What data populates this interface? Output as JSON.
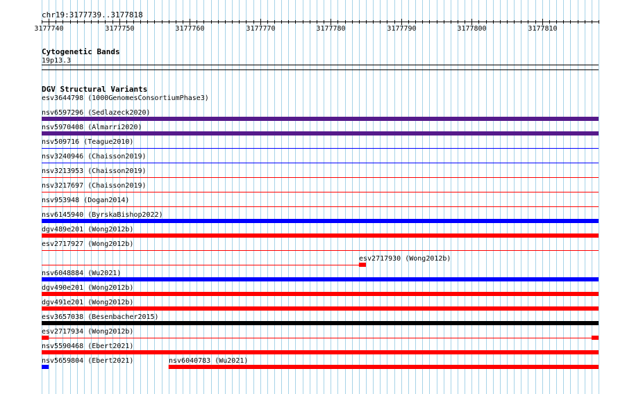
{
  "location": {
    "label": "chr19:3177739..3177818",
    "start": 3177739,
    "end": 3177818
  },
  "ruler": {
    "ticks": [
      3177740,
      3177750,
      3177760,
      3177770,
      3177780,
      3177790,
      3177800,
      3177810
    ]
  },
  "colors": {
    "grid": "#a6d3e8",
    "ruler": "#000000",
    "sv_red": "#ff0000",
    "sv_blue": "#0000ff",
    "sv_purple": "#551a8b",
    "sv_black": "#000000"
  },
  "cytobands": {
    "title": "Cytogenetic Bands",
    "band": "19p13.3"
  },
  "dgv": {
    "title": "DGV Structural Variants",
    "features": [
      {
        "label": "esv3644798 (1000GenomesConsortiumPhase3)",
        "lane": 0,
        "line_color": "",
        "blocks": []
      },
      {
        "label": "nsv6597296 (Sedlazeck2020)",
        "lane": 1,
        "line_color": "sv_purple",
        "blocks": [
          {
            "start": 3177739,
            "end": 3177818,
            "color": "sv_purple"
          }
        ]
      },
      {
        "label": "nsv5970408 (Almarri2020)",
        "lane": 2,
        "line_color": "sv_purple",
        "blocks": [
          {
            "start": 3177739,
            "end": 3177818,
            "color": "sv_purple"
          }
        ]
      },
      {
        "label": "nsv509716 (Teague2010)",
        "lane": 3,
        "line_color": "sv_blue",
        "blocks": []
      },
      {
        "label": "nsv3240946 (Chaisson2019)",
        "lane": 4,
        "line_color": "sv_blue",
        "blocks": []
      },
      {
        "label": "nsv3213953 (Chaisson2019)",
        "lane": 5,
        "line_color": "sv_red",
        "blocks": []
      },
      {
        "label": "nsv3217697 (Chaisson2019)",
        "lane": 6,
        "line_color": "sv_red",
        "blocks": []
      },
      {
        "label": "nsv953948 (Dogan2014)",
        "lane": 7,
        "line_color": "sv_red",
        "blocks": []
      },
      {
        "label": "nsv6145940 (ByrskaBishop2022)",
        "lane": 8,
        "line_color": "sv_blue",
        "blocks": [
          {
            "start": 3177739,
            "end": 3177818,
            "color": "sv_blue"
          }
        ]
      },
      {
        "label": "dgv489e201 (Wong2012b)",
        "lane": 9,
        "line_color": "sv_red",
        "blocks": [
          {
            "start": 3177739,
            "end": 3177818,
            "color": "sv_red"
          }
        ]
      },
      {
        "label": "esv2717927 (Wong2012b)",
        "lane": 10,
        "line_color": "sv_red",
        "blocks": []
      },
      {
        "label": "esv2717930 (Wong2012b)",
        "lane": 11,
        "line_color": "sv_red",
        "line_end": 3177785,
        "blocks": [
          {
            "start": 3177784,
            "end": 3177785,
            "color": "sv_red"
          }
        ]
      },
      {
        "label": "nsv6048884 (Wu2021)",
        "lane": 12,
        "line_color": "sv_blue",
        "blocks": [
          {
            "start": 3177739,
            "end": 3177818,
            "color": "sv_blue"
          }
        ]
      },
      {
        "label": "dgv490e201 (Wong2012b)",
        "lane": 13,
        "line_color": "sv_red",
        "blocks": [
          {
            "start": 3177739,
            "end": 3177818,
            "color": "sv_red"
          }
        ]
      },
      {
        "label": "dgv491e201 (Wong2012b)",
        "lane": 14,
        "line_color": "sv_red",
        "blocks": [
          {
            "start": 3177739,
            "end": 3177818,
            "color": "sv_red"
          }
        ]
      },
      {
        "label": "esv3657038 (Besenbacher2015)",
        "lane": 15,
        "line_color": "sv_black",
        "blocks": [
          {
            "start": 3177739,
            "end": 3177818,
            "color": "sv_black"
          }
        ]
      },
      {
        "label": "esv2717934 (Wong2012b)",
        "lane": 16,
        "line_color": "sv_red",
        "blocks": [
          {
            "start": 3177739,
            "end": 3177740,
            "color": "sv_red"
          },
          {
            "start": 3177817,
            "end": 3177818,
            "color": "sv_red"
          }
        ]
      },
      {
        "label": "nsv5590468 (Ebert2021)",
        "lane": 17,
        "line_color": "sv_red",
        "blocks": [
          {
            "start": 3177739,
            "end": 3177818,
            "color": "sv_red"
          }
        ]
      },
      {
        "label": "nsv5659804 (Ebert2021)",
        "lane": 18,
        "line_color": "",
        "blocks": [
          {
            "start": 3177739,
            "end": 3177740,
            "color": "sv_blue"
          }
        ]
      },
      {
        "label": "nsv6040783 (Wu2021)",
        "lane": 18,
        "line_color": "",
        "blocks": [
          {
            "start": 3177757,
            "end": 3177818,
            "color": "sv_red"
          }
        ]
      }
    ]
  }
}
